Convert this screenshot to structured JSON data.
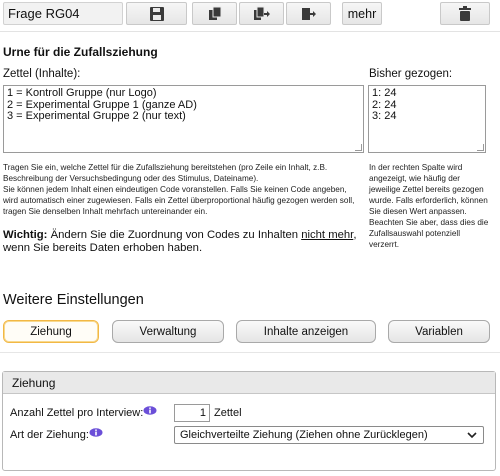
{
  "toolbar": {
    "question_id": "Frage RG04",
    "save_icon": "floppy-disk-icon",
    "copy_icon": "duplicate-icon",
    "copy_to_icon": "copy-to-icon",
    "move_icon": "move-to-icon",
    "more_label": "mehr",
    "delete_icon": "trash-icon"
  },
  "urn": {
    "title": "Urne für die Zufallsziehung",
    "items_label": "Zettel (Inhalte):",
    "items": [
      "1 = Kontroll Gruppe (nur Logo)",
      "2 = Experimental Gruppe 1 (ganze AD)",
      "3 = Experimental Gruppe 2 (nur text)"
    ],
    "drawn_label": "Bisher gezogen:",
    "drawn": [
      "1: 24",
      "2: 24",
      "3: 24"
    ],
    "help_main": [
      "Tragen Sie ein, welche Zettel für die Zufallsziehung bereitstehen (pro Zeile ein Inhalt, z.B. Beschreibung der Versuchsbedingung oder des Stimulus, Dateiname).",
      "Sie können jedem Inhalt einen eindeutigen Code voranstellen. Falls Sie keinen Code angeben, wird automatisch einer zugewiesen. Falls ein Zettel überproportional häufig gezogen werden soll, tragen Sie denselben Inhalt mehrfach untereinander ein."
    ],
    "help_side": "In der rechten Spalte wird angezeigt, wie häufig der jeweilige Zettel bereits gezogen wurde. Falls erforderlich, können Sie diesen Wert anpassen. Beachten Sie aber, dass dies die Zufallsauswahl potenziell verzerrt.",
    "warning_bold": "Wichtig:",
    "warning_pre": " Ändern Sie die Zuordnung von Codes zu Inhalten ",
    "warning_underline": "nicht mehr",
    "warning_post": ", wenn Sie bereits Daten erhoben haben."
  },
  "settings": {
    "title": "Weitere Einstellungen",
    "tabs": [
      {
        "label": "Ziehung",
        "active": true
      },
      {
        "label": "Verwaltung",
        "active": false
      },
      {
        "label": "Inhalte anzeigen",
        "active": false
      },
      {
        "label": "Variablen",
        "active": false
      }
    ]
  },
  "draw_panel": {
    "title": "Ziehung",
    "count_label": "Anzahl Zettel pro Interview:",
    "count_value": "1",
    "count_unit": "Zettel",
    "mode_label": "Art der Ziehung:",
    "mode_value": "Gleichverteilte Ziehung (Ziehen ohne Zurücklegen)",
    "info_icon": "info-icon"
  },
  "colors": {
    "accent_active_border": "#f2b845",
    "info_icon": "#6b4fd8"
  }
}
